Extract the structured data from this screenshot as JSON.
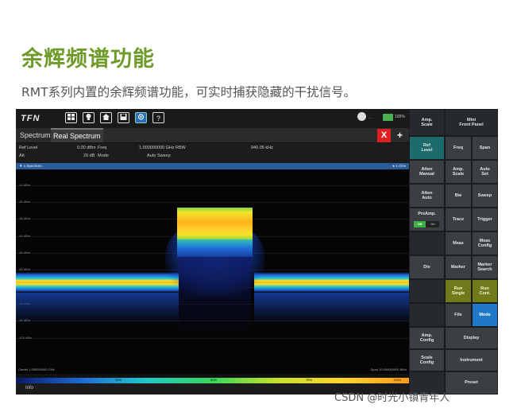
{
  "heading": "余辉频谱功能",
  "subtitle": "RMT系列内置的余辉频谱功能，可实时捕获隐藏的干扰信号。",
  "watermark": "CSDN @时光小镇青年人",
  "device": {
    "logo": "TFN",
    "toolbar_icons": [
      "windows-icon",
      "lightbulb-icon",
      "home-icon",
      "save-icon",
      "camera-icon",
      "help-icon"
    ],
    "help_glyph": "?",
    "gps_text": "---",
    "battery_text": "100%",
    "tabs": [
      "Spectrum",
      "Real Spectrum"
    ],
    "close_label": "X",
    "add_label": "+",
    "params": {
      "ref_level_label": "Ref Level",
      "ref_level_value": "0.00 dBm",
      "freq_label": "Freq",
      "freq_value": "1.000000000 GHz",
      "rbw_label": "RBW",
      "rbw_value": "940.05 kHz",
      "att_label": "Att",
      "att_value": "20 dB",
      "mode_label": "Mode",
      "mode_value": "Auto Sweep"
    },
    "trace_label": "▼ 1 Spectrum",
    "trace_right": "● 1 Clrw",
    "y_labels": [
      "-10 dBm",
      "-20 dBm",
      "-30 dBm",
      "-40 dBm",
      "-50 dBm",
      "-60 dBm",
      "-70 dBm",
      "-80 dBm",
      "-90 dBm",
      "-100 dBm"
    ],
    "center_text": "Center 1.000000000 GHz",
    "span_text": "Span 10.000000000 MHz",
    "colorbar_labels": [
      "0%",
      "25%",
      "50%",
      "75%",
      "100%"
    ],
    "info_label": "Info",
    "right_panel": {
      "amp_scale": "Amp.\nScale",
      "mini_front_panel": "Mini\nFront Panel",
      "ref_level": "Ref\nLevel",
      "freq": "Freq",
      "span": "Span",
      "atten_manual": "Atten\nManual",
      "amp_scale_2": "Amp.\nScale",
      "auto_set": "Auto\nSet",
      "atten_auto": "Atten\nAuto",
      "bw": "Bw",
      "sweep": "Sweep",
      "preamp": "PreAmp.",
      "preamp_off": "Off",
      "preamp_on": "On",
      "trace": "Trace",
      "trigger": "Trigger",
      "meas": "Meas",
      "meas_config": "Meas\nConfig",
      "div": "Div",
      "marker": "Marker",
      "marker_search": "Marker\nSearch",
      "run_single": "Run\nSingle",
      "run_cont": "Run\nCont.",
      "file": "File",
      "mode": "Mode",
      "amp_config": "Amp.\nConfig",
      "display": "Display",
      "scale_config": "Scale\nConfig",
      "instrument": "Instrument",
      "preset": "Preset"
    },
    "colors": {
      "heading_green": "#6f9b2a",
      "trace_blue": "#2a5d9a",
      "close_red": "#e02020",
      "run_olive": "#6f7a1a",
      "mode_blue": "#1f78c8",
      "teal": "#1e6b6b"
    }
  }
}
